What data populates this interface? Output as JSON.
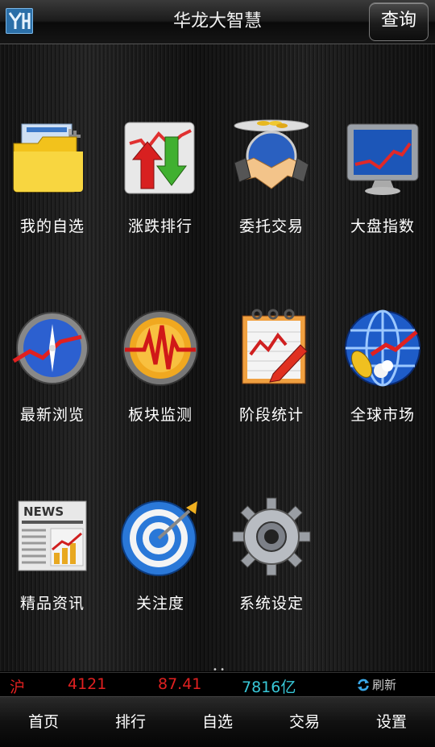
{
  "header": {
    "title": "华龙大智慧",
    "query_label": "查询",
    "logo_icon": "hualong-logo-icon"
  },
  "tiles": [
    {
      "label": "我的自选",
      "icon": "folder-icon"
    },
    {
      "label": "涨跌排行",
      "icon": "up-down-arrows-icon"
    },
    {
      "label": "委托交易",
      "icon": "handshake-icon"
    },
    {
      "label": "大盘指数",
      "icon": "monitor-chart-icon"
    },
    {
      "label": "最新浏览",
      "icon": "compass-clock-icon"
    },
    {
      "label": "板块监测",
      "icon": "gauge-pulse-icon"
    },
    {
      "label": "阶段统计",
      "icon": "notebook-chart-icon"
    },
    {
      "label": "全球市场",
      "icon": "globe-icon"
    },
    {
      "label": "精品资讯",
      "icon": "news-icon"
    },
    {
      "label": "关注度",
      "icon": "target-icon"
    },
    {
      "label": "系统设定",
      "icon": "gear-icon"
    }
  ],
  "pager": "• •",
  "ticker": {
    "name": "沪",
    "price": "4121",
    "change": "87.41",
    "volume": "7816亿",
    "refresh_label": "刷新"
  },
  "nav": [
    "首页",
    "排行",
    "自选",
    "交易",
    "设置"
  ],
  "colors": {
    "up": "#e02020",
    "volume": "#38c8d8",
    "background": "#000000"
  }
}
